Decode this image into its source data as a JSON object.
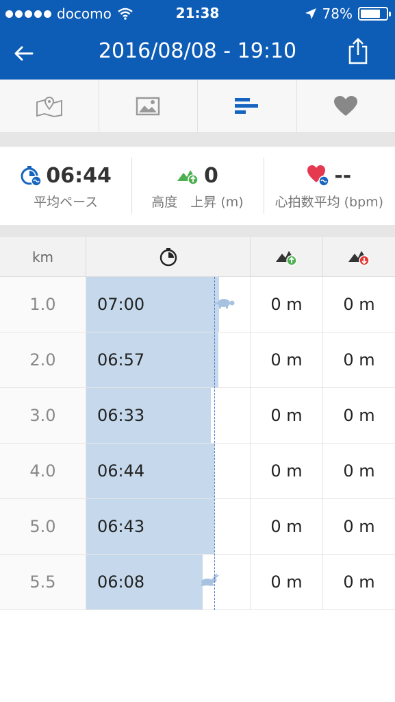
{
  "status_bar": {
    "carrier": "docomo",
    "time": "21:38",
    "battery": "78%",
    "battery_level": 0.78
  },
  "nav": {
    "title": "2016/08/08 - 19:10"
  },
  "tabs": [
    {
      "icon": "map-icon",
      "active": false
    },
    {
      "icon": "photo-icon",
      "active": false
    },
    {
      "icon": "splits-icon",
      "active": true
    },
    {
      "icon": "heart-icon",
      "active": false
    }
  ],
  "summary": {
    "avg_pace": {
      "value": "06:44",
      "label": "平均ペース"
    },
    "elevation": {
      "value": "0",
      "label": "高度　上昇 (m)"
    },
    "heart_rate": {
      "value": "--",
      "label": "心拍数平均 (bpm)"
    }
  },
  "table": {
    "header_km": "km",
    "rows": [
      {
        "km": "1.0",
        "pace": "07:00",
        "pace_seconds": 420,
        "ascent": "0 m",
        "descent": "0 m",
        "marker": "turtle"
      },
      {
        "km": "2.0",
        "pace": "06:57",
        "pace_seconds": 417,
        "ascent": "0 m",
        "descent": "0 m",
        "marker": ""
      },
      {
        "km": "3.0",
        "pace": "06:33",
        "pace_seconds": 393,
        "ascent": "0 m",
        "descent": "0 m",
        "marker": ""
      },
      {
        "km": "4.0",
        "pace": "06:44",
        "pace_seconds": 404,
        "ascent": "0 m",
        "descent": "0 m",
        "marker": ""
      },
      {
        "km": "5.0",
        "pace": "06:43",
        "pace_seconds": 403,
        "ascent": "0 m",
        "descent": "0 m",
        "marker": ""
      },
      {
        "km": "5.5",
        "pace": "06:08",
        "pace_seconds": 368,
        "ascent": "0 m",
        "descent": "0 m",
        "marker": "rabbit"
      }
    ],
    "average_pace_seconds": 404
  },
  "colors": {
    "brand": "#0d5cb6",
    "bar": "#c6d9ec",
    "avg_line": "#4c7cc7",
    "ascent": "#4caf50",
    "descent": "#e53935",
    "heart": "#e53950"
  }
}
